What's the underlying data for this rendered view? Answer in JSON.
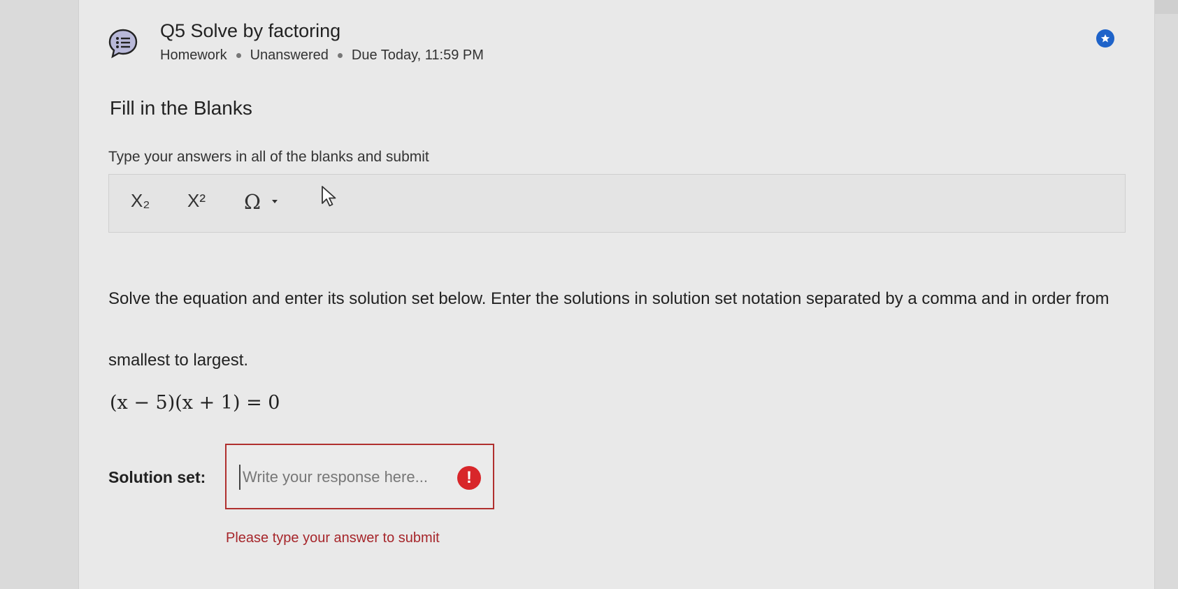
{
  "header": {
    "title": "Q5 Solve by factoring",
    "meta": [
      "Homework",
      "Unanswered",
      "Due Today, 11:59 PM"
    ],
    "question_icon": "list-chat-icon",
    "flag_icon": "star-icon"
  },
  "section": {
    "title": "Fill in the Blanks",
    "instruction": "Type your answers in all of the blanks and submit"
  },
  "toolbar": {
    "subscript_label": "X₂",
    "superscript_label": "X²",
    "special_chars_label": "Ω"
  },
  "problem": {
    "text": "Solve the equation and enter its solution set below. Enter the solutions in solution set notation separated by a comma and in order from smallest to largest.",
    "equation": "(x − 5)(x + 1) = 0"
  },
  "answer": {
    "label": "Solution set:",
    "value": "",
    "placeholder": "Write your response here...",
    "error_symbol": "!",
    "error_message": "Please type your answer to submit"
  },
  "colors": {
    "accent": "#1f63c9",
    "error": "#b0302f",
    "error_icon": "#d8262a",
    "icon_fill": "#b9b9d9"
  }
}
